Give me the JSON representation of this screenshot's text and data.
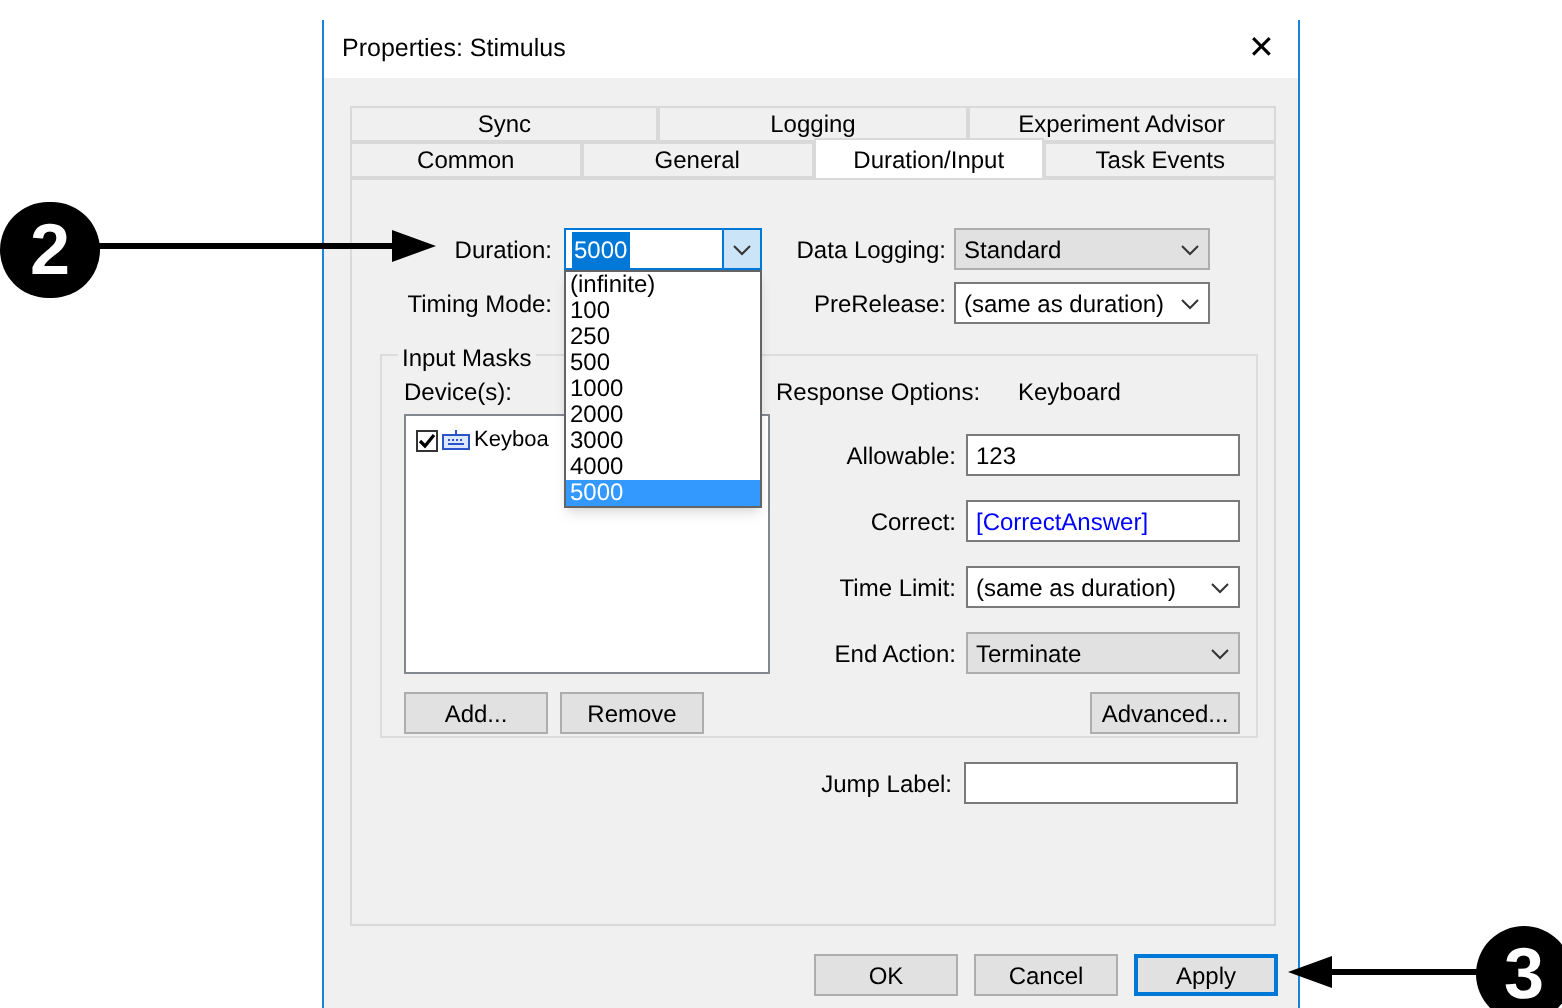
{
  "window": {
    "title": "Properties: Stimulus",
    "close": "✕"
  },
  "tab_rows": [
    {
      "tabs": [
        {
          "label": "Sync",
          "selected": false
        },
        {
          "label": "Logging",
          "selected": false
        },
        {
          "label": "Experiment Advisor",
          "selected": false
        }
      ]
    },
    {
      "tabs": [
        {
          "label": "Common",
          "selected": false
        },
        {
          "label": "General",
          "selected": false
        },
        {
          "label": "Duration/Input",
          "selected": true
        },
        {
          "label": "Task Events",
          "selected": false
        }
      ]
    }
  ],
  "duration": {
    "label": "Duration:",
    "value": "5000",
    "expanded": true,
    "options": [
      {
        "label": "(infinite)",
        "selected": false
      },
      {
        "label": "100",
        "selected": false
      },
      {
        "label": "250",
        "selected": false
      },
      {
        "label": "500",
        "selected": false
      },
      {
        "label": "1000",
        "selected": false
      },
      {
        "label": "2000",
        "selected": false
      },
      {
        "label": "3000",
        "selected": false
      },
      {
        "label": "4000",
        "selected": false
      },
      {
        "label": "5000",
        "selected": true
      }
    ]
  },
  "timing_mode": {
    "label": "Timing Mode:"
  },
  "data_logging": {
    "kind": "list",
    "label": "Data Logging:",
    "value": "Standard"
  },
  "prerelease": {
    "kind": "combo",
    "label": "PreRelease:",
    "value": "(same as duration)"
  },
  "input_masks": {
    "title": "Input Masks",
    "devices_label": "Device(s):",
    "devices": [
      {
        "label": "Keyboa",
        "checked": true
      }
    ],
    "buttons": [
      "Add...",
      "Remove"
    ]
  },
  "response": {
    "label": "Response Options:",
    "device": "Keyboard",
    "fields": [
      {
        "kind": "text",
        "label": "Allowable:",
        "value": "123"
      },
      {
        "kind": "reference",
        "label": "Correct:",
        "value": "[CorrectAnswer]"
      },
      {
        "kind": "combo",
        "label": "Time Limit:",
        "value": "(same as duration)"
      },
      {
        "kind": "list",
        "label": "End Action:",
        "value": "Terminate"
      }
    ],
    "advanced": "Advanced..."
  },
  "jump_label": {
    "label": "Jump Label:"
  },
  "buttons": [
    {
      "label": "OK",
      "focused": false
    },
    {
      "label": "Cancel",
      "focused": false
    },
    {
      "label": "Apply",
      "focused": true
    }
  ],
  "callouts": [
    {
      "number": "2"
    },
    {
      "number": "3"
    }
  ]
}
